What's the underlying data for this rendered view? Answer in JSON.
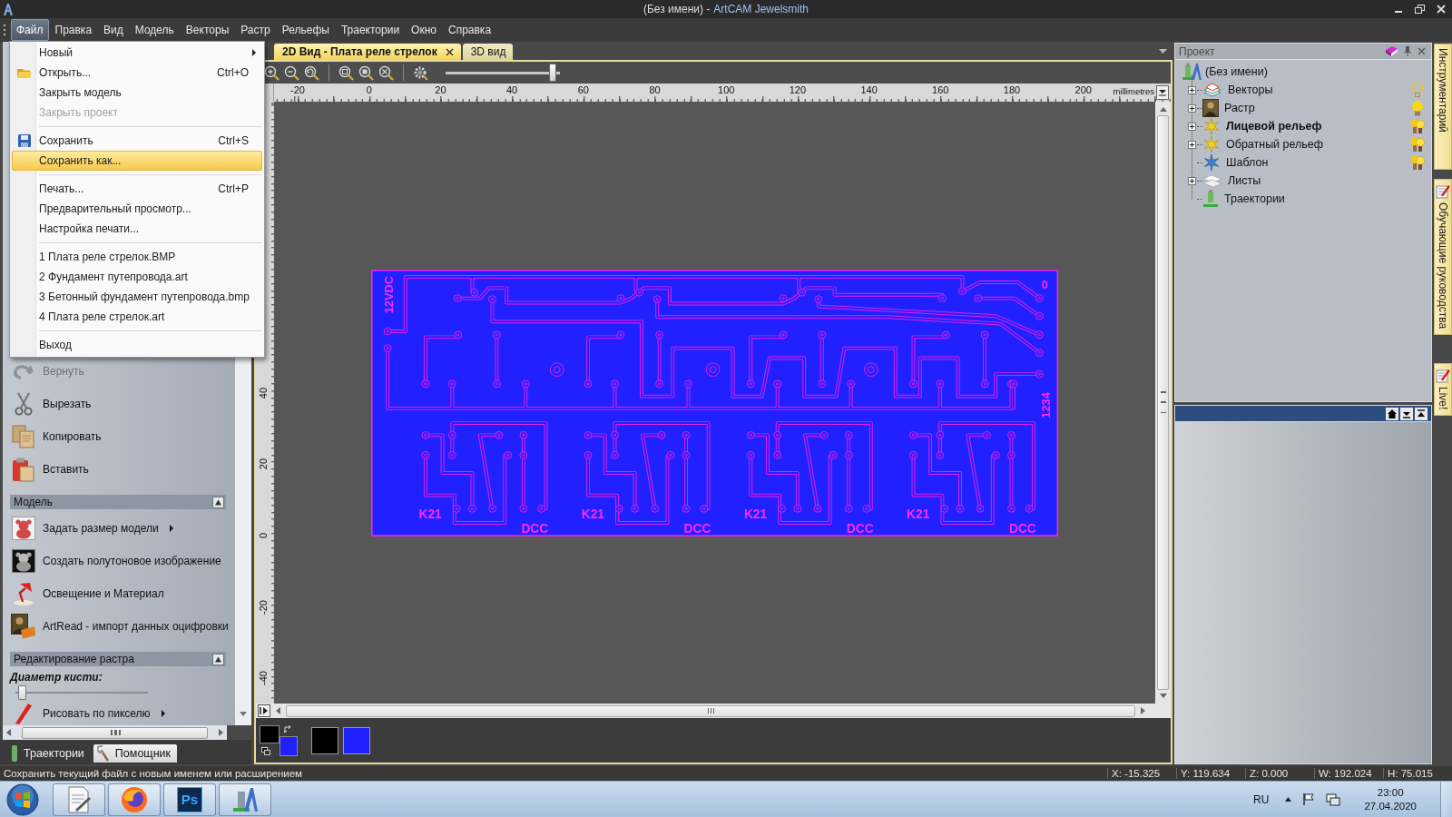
{
  "window": {
    "title": "(Без имени) -",
    "app_name": "ArtCAM Jewelsmith"
  },
  "menu_bar": [
    {
      "label": "Файл",
      "selected": true
    },
    {
      "label": "Правка",
      "selected": false
    },
    {
      "label": "Вид",
      "selected": false
    },
    {
      "label": "Модель",
      "selected": false
    },
    {
      "label": "Векторы",
      "selected": false
    },
    {
      "label": "Растр",
      "selected": false
    },
    {
      "label": "Рельефы",
      "selected": false
    },
    {
      "label": "Траектории",
      "selected": false
    },
    {
      "label": "Окно",
      "selected": false
    },
    {
      "label": "Справка",
      "selected": false
    }
  ],
  "file_menu": [
    {
      "kind": "plain",
      "label": "Новый",
      "submenu": true,
      "disabled": false,
      "selected": false
    },
    {
      "kind": "open",
      "label": "Открыть...",
      "shortcut": "Ctrl+O",
      "submenu": false,
      "disabled": false,
      "selected": false
    },
    {
      "kind": "plain",
      "label": "Закрыть модель",
      "submenu": false,
      "disabled": false,
      "selected": false
    },
    {
      "kind": "plain",
      "label": "Закрыть проект",
      "submenu": false,
      "disabled": true,
      "selected": false
    },
    {
      "kind": "separator"
    },
    {
      "kind": "save",
      "label": "Сохранить",
      "shortcut": "Ctrl+S",
      "submenu": false,
      "disabled": false,
      "selected": false
    },
    {
      "kind": "plain",
      "label": "Сохранить как...",
      "submenu": false,
      "disabled": false,
      "selected": true
    },
    {
      "kind": "separator"
    },
    {
      "kind": "plain",
      "label": "Печать...",
      "shortcut": "Ctrl+P",
      "submenu": false,
      "disabled": false,
      "selected": false
    },
    {
      "kind": "plain",
      "label": "Предварительный просмотр...",
      "submenu": false,
      "disabled": false,
      "selected": false
    },
    {
      "kind": "plain",
      "label": "Настройка печати...",
      "submenu": false,
      "disabled": false,
      "selected": false
    },
    {
      "kind": "separator"
    },
    {
      "kind": "plain",
      "label": "1 Плата реле стрелок.BMP",
      "submenu": false,
      "disabled": false,
      "selected": false
    },
    {
      "kind": "plain",
      "label": "2 Фундамент путепровода.art",
      "submenu": false,
      "disabled": false,
      "selected": false
    },
    {
      "kind": "plain",
      "label": "3 Бетонный фундамент путепровода.bmp",
      "submenu": false,
      "disabled": false,
      "selected": false
    },
    {
      "kind": "plain",
      "label": "4 Плата реле стрелок.art",
      "submenu": false,
      "disabled": false,
      "selected": false
    },
    {
      "kind": "separator"
    },
    {
      "kind": "plain",
      "label": "Выход",
      "submenu": false,
      "disabled": false,
      "selected": false
    }
  ],
  "assistant_panel": {
    "tools": [
      {
        "kind": "redo",
        "label": "Вернуть",
        "disabled": true
      },
      {
        "kind": "cut",
        "label": "Вырезать",
        "disabled": false
      },
      {
        "kind": "copy",
        "label": "Копировать",
        "disabled": false
      },
      {
        "kind": "paste",
        "label": "Вставить",
        "disabled": false
      }
    ],
    "sections": [
      {
        "title": "Модель",
        "expanded": true,
        "items": [
          {
            "kind": "model-size",
            "label": "Задать размер модели",
            "submenu": true
          },
          {
            "kind": "grayscale",
            "label": "Создать полутоновое изображение",
            "submenu": false
          },
          {
            "kind": "lighting",
            "label": "Освещение и Материал",
            "submenu": false
          },
          {
            "kind": "artread",
            "label": "ArtRead - импорт данных оцифровки",
            "submenu": false
          }
        ]
      },
      {
        "title": "Редактирование растра",
        "expanded": true,
        "brush": {
          "label": "Диаметр кисти:",
          "level": 0.02
        },
        "items": [
          {
            "kind": "pixel-draw",
            "label": "Рисовать по пикселю",
            "submenu": true
          }
        ]
      }
    ],
    "bottom_tabs": [
      {
        "kind": "toolpaths",
        "label": "Траектории",
        "selected": false
      },
      {
        "kind": "assistant",
        "label": "Помощник",
        "selected": true
      }
    ]
  },
  "view_tabs": [
    {
      "label": "2D Вид - Плата реле стрелок",
      "selected": true,
      "closable": true
    },
    {
      "label": "3D вид",
      "selected": false,
      "closable": false
    }
  ],
  "view_toolbar": {
    "zoom_slider": {
      "level": 0.97
    }
  },
  "ruler": {
    "unit": "millimetres",
    "x_labels": [
      "-20",
      "0",
      "20",
      "40",
      "60",
      "80",
      "100",
      "120",
      "140",
      "160",
      "180",
      "200"
    ],
    "y_labels": [
      "40",
      "20",
      "0",
      "-20",
      "-40"
    ]
  },
  "board": {
    "power_label": "12VDC",
    "corner_label": "0",
    "connector_label": "1234",
    "relays": [
      {
        "label": "K21",
        "output": "DCC"
      },
      {
        "label": "K21",
        "output": "DCC"
      },
      {
        "label": "K21",
        "output": "DCC"
      },
      {
        "label": "K21",
        "output": "DCC"
      }
    ]
  },
  "color_swatches": {
    "current": [
      {
        "color": "#000000"
      },
      {
        "color": "#2020ff"
      }
    ],
    "palette": [
      {
        "color": "#000000"
      },
      {
        "color": "#2020ff"
      }
    ]
  },
  "project_panel": {
    "title": "Проект",
    "root": {
      "kind": "project",
      "label": "(Без имени)",
      "children": [
        {
          "kind": "vectors",
          "label": "Векторы",
          "expandable": true,
          "expanded": false,
          "active": false,
          "lamp": {
            "on": false,
            "double": false
          }
        },
        {
          "kind": "raster",
          "label": "Растр",
          "expandable": true,
          "expanded": false,
          "active": false,
          "lamp": {
            "on": true,
            "double": false
          }
        },
        {
          "kind": "relief",
          "label": "Лицевой рельеф",
          "expandable": true,
          "expanded": false,
          "active": true,
          "lamp": {
            "on": true,
            "double": true
          }
        },
        {
          "kind": "relief",
          "label": "Обратный рельеф",
          "expandable": true,
          "expanded": false,
          "active": false,
          "lamp": {
            "on": true,
            "double": true
          }
        },
        {
          "kind": "template",
          "label": "Шаблон",
          "expandable": false,
          "active": false,
          "lamp": {
            "on": true,
            "double": true
          }
        },
        {
          "kind": "sheets",
          "label": "Листы",
          "expandable": true,
          "expanded": false,
          "active": false
        },
        {
          "kind": "toolpaths",
          "label": "Траектории",
          "expandable": false,
          "active": false
        }
      ]
    }
  },
  "side_tabs": [
    {
      "label": "Инструментарий",
      "icon": false
    },
    {
      "label": "Обучающие руководства",
      "icon": true
    },
    {
      "label": "Live!",
      "icon": true
    }
  ],
  "status_bar": {
    "message": "Сохранить текущий файл с новым именем или расширением",
    "readouts": [
      "X: -15.325",
      "Y: 119.634",
      "Z: 0.000",
      "W: 192.024",
      "H: 75.015"
    ]
  },
  "taskbar": {
    "apps": [
      {
        "kind": "document"
      },
      {
        "kind": "browser"
      },
      {
        "kind": "photoshop",
        "label": "Ps"
      },
      {
        "kind": "artcam"
      }
    ],
    "language": "RU",
    "time": "23:00",
    "date": "27.04.2020"
  }
}
